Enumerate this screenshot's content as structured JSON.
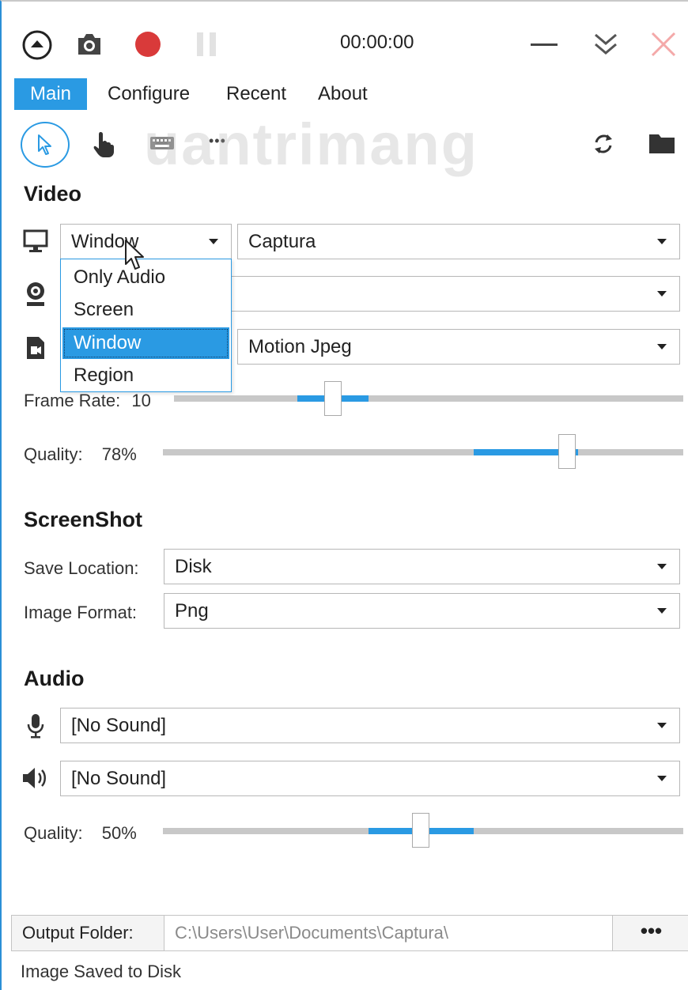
{
  "titlebar": {
    "timer": "00:00:00",
    "icons": [
      "collapse-up-icon",
      "camera-icon",
      "record-icon",
      "pause-icon",
      "minimize-icon",
      "chevron-double-down-icon",
      "close-icon"
    ],
    "record_color": "#d93a3a",
    "close_color": "#f4a9a9"
  },
  "tabs": [
    {
      "label": "Main",
      "active": true
    },
    {
      "label": "Configure",
      "active": false
    },
    {
      "label": "Recent",
      "active": false
    },
    {
      "label": "About",
      "active": false
    }
  ],
  "toolbar": {
    "icons": [
      "cursor-icon",
      "hand-pointer-icon",
      "keyboard-icon",
      "more-icon",
      "refresh-icon",
      "folder-icon"
    ],
    "more_label": "•••"
  },
  "watermark": "uantrimang",
  "video": {
    "title": "Video",
    "source_value": "Window",
    "source_options": [
      "Only Audio",
      "Screen",
      "Window",
      "Region"
    ],
    "window_value": "Captura",
    "webcam_value": "",
    "codec_value": "Motion Jpeg",
    "frame_rate_label": "Frame Rate:",
    "frame_rate_value": "10",
    "quality_label": "Quality:",
    "quality_value": "78%"
  },
  "screenshot": {
    "title": "ScreenShot",
    "save_location_label": "Save Location:",
    "save_location_value": "Disk",
    "image_format_label": "Image Format:",
    "image_format_value": "Png"
  },
  "audio": {
    "title": "Audio",
    "mic_value": "[No Sound]",
    "speaker_value": "[No Sound]",
    "quality_label": "Quality:",
    "quality_value": "50%"
  },
  "footer": {
    "output_folder_label": "Output Folder:",
    "output_folder_path": "C:\\Users\\User\\Documents\\Captura\\",
    "browse_label": "•••",
    "status": "Image Saved to Disk"
  },
  "colors": {
    "accent": "#2a9ae3",
    "window_border": "#2b8fd6"
  }
}
